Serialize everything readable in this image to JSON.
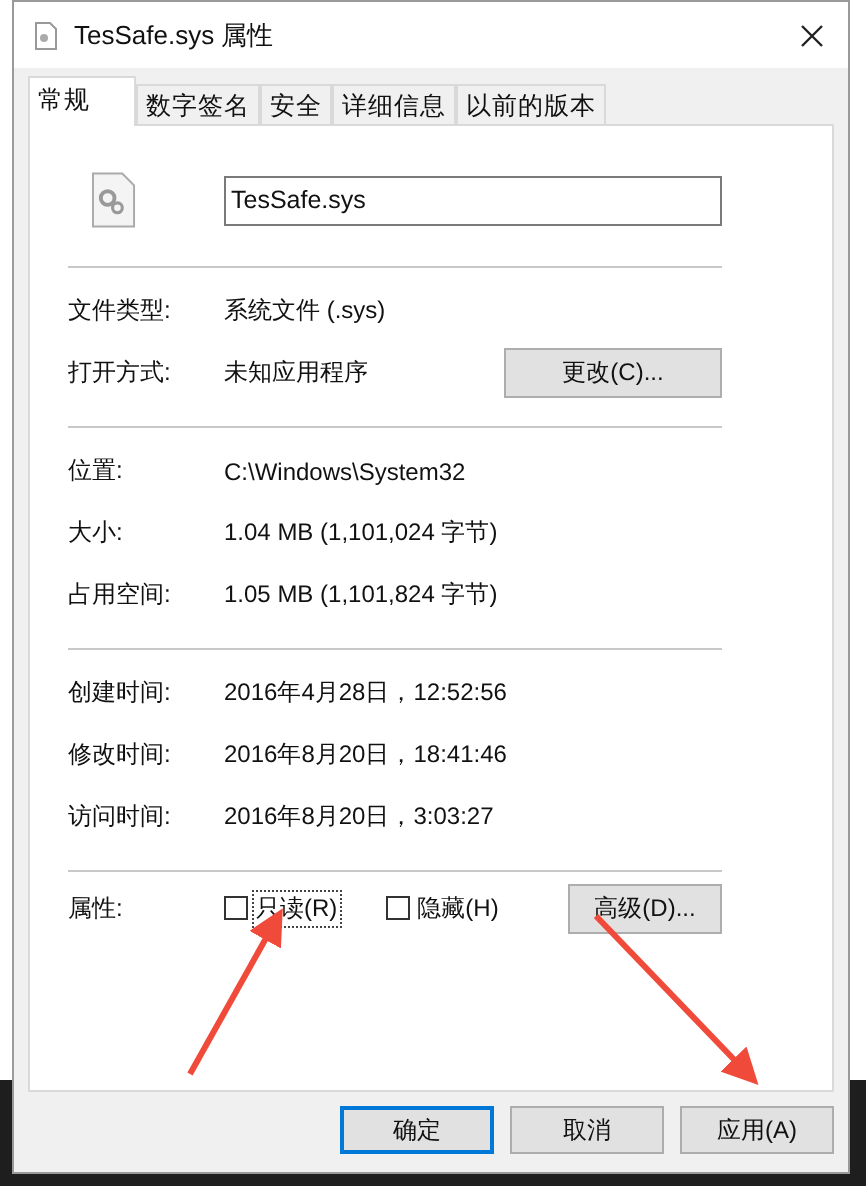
{
  "window": {
    "title": "TesSafe.sys 属性"
  },
  "tabs": [
    {
      "label": "常规",
      "selected": true
    },
    {
      "label": "数字签名",
      "selected": false
    },
    {
      "label": "安全",
      "selected": false
    },
    {
      "label": "详细信息",
      "selected": false
    },
    {
      "label": "以前的版本",
      "selected": false
    }
  ],
  "file": {
    "name": "TesSafe.sys"
  },
  "sections": [
    [
      {
        "label": "文件类型:",
        "value": "系统文件 (.sys)"
      },
      {
        "label": "打开方式:",
        "value": "未知应用程序",
        "button": "更改(C)..."
      }
    ],
    [
      {
        "label": "位置:",
        "value": "C:\\Windows\\System32"
      },
      {
        "label": "大小:",
        "value": "1.04 MB (1,101,024 字节)"
      },
      {
        "label": "占用空间:",
        "value": "1.05 MB (1,101,824 字节)"
      }
    ],
    [
      {
        "label": "创建时间:",
        "value": "2016年4月28日，12:52:56"
      },
      {
        "label": "修改时间:",
        "value": "2016年8月20日，18:41:46"
      },
      {
        "label": "访问时间:",
        "value": "2016年8月20日，3:03:27"
      }
    ]
  ],
  "attributes": {
    "label": "属性:",
    "checkboxes": [
      {
        "label": "只读(R)",
        "checked": false,
        "focused": true
      },
      {
        "label": "隐藏(H)",
        "checked": false,
        "focused": false
      }
    ],
    "button": "高级(D)..."
  },
  "buttons": [
    {
      "label": "确定",
      "default": true
    },
    {
      "label": "取消",
      "default": false
    },
    {
      "label": "应用(A)",
      "default": false
    }
  ]
}
